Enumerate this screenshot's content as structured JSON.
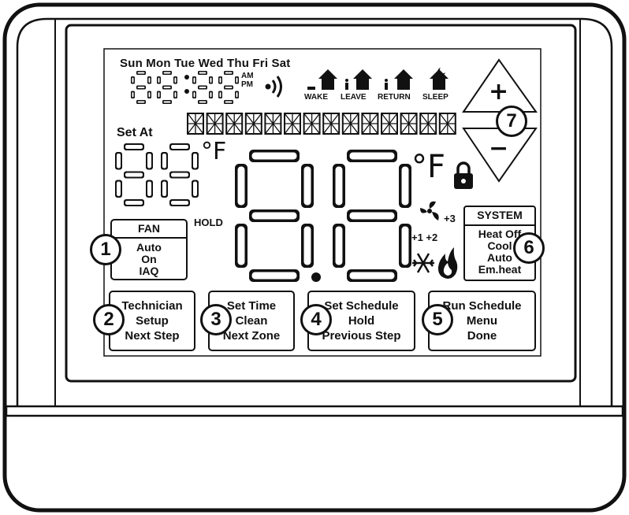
{
  "days_label": "Sun Mon Tue Wed Thu Fri Sat",
  "clock": {
    "digits": "88:88",
    "am": "AM",
    "pm": "PM",
    "signal_icon": "wireless-signal-icon"
  },
  "periods": [
    "WAKE",
    "LEAVE",
    "RETURN",
    "SLEEP"
  ],
  "period_icons": [
    "house-wake-icon",
    "house-leave-icon",
    "house-return-icon",
    "house-sleep-icon"
  ],
  "text_segment_count": 14,
  "set_at": {
    "label": "Set At",
    "digits": "88",
    "unit": "°F"
  },
  "main_temp": {
    "digits": "88",
    "unit": "°F",
    "lock_icon": "lock-icon"
  },
  "hold_label": "HOLD",
  "fan_stages": {
    "top": "+3",
    "bottom": "+1 +2",
    "fan_icon": "fan-icon",
    "cool_icon": "snowflake-icon",
    "heat_icon": "flame-icon"
  },
  "fan_box": {
    "title": "FAN",
    "items": [
      "Auto",
      "On",
      "IAQ"
    ]
  },
  "system_box": {
    "title": "SYSTEM",
    "items": [
      "Heat Off",
      "Cool",
      "Auto",
      "Em.heat"
    ]
  },
  "buttons": [
    {
      "lines": [
        "Technician",
        "Setup",
        "Next Step"
      ]
    },
    {
      "lines": [
        "Set Time",
        "Clean",
        "Next Zone"
      ]
    },
    {
      "lines": [
        "Set Schedule",
        "Hold",
        "Previous Step"
      ]
    },
    {
      "lines": [
        "Run Schedule",
        "Menu",
        "Done"
      ]
    }
  ],
  "callouts": [
    "1",
    "2",
    "3",
    "4",
    "5",
    "6",
    "7"
  ],
  "updown": {
    "plus": "+",
    "minus": "−"
  }
}
